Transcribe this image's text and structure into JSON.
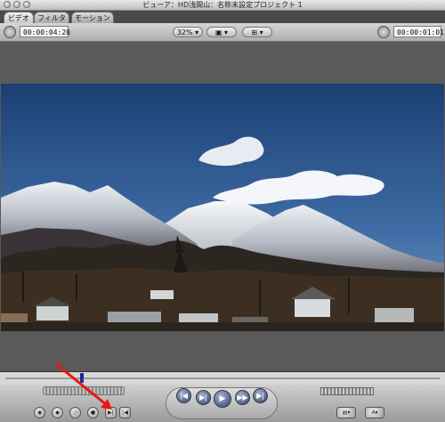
{
  "window": {
    "title": "ビューア：HD浅間山：名称未設定プロジェクト 1"
  },
  "tabs": [
    {
      "label": "ビデオ"
    },
    {
      "label": "フィルタ"
    },
    {
      "label": "モーション"
    }
  ],
  "toolbar": {
    "timecode_left": "00:00:04:20",
    "zoom_label": "32%",
    "timecode_right": "00:00:01:01"
  },
  "icons": {
    "timecode_dial": "dial-icon",
    "view_options": "view-options-icon",
    "overlay": "overlay-icon",
    "go_start": "go-to-start-icon",
    "play_in_out": "play-in-out-icon",
    "play": "play-icon",
    "play_around": "play-around-icon",
    "go_end": "go-to-end-icon",
    "mark_in": "mark-in-icon",
    "mark_out": "mark-out-icon",
    "annotation": "red-arrow"
  },
  "colors": {
    "annotation_arrow": "#e81616"
  }
}
